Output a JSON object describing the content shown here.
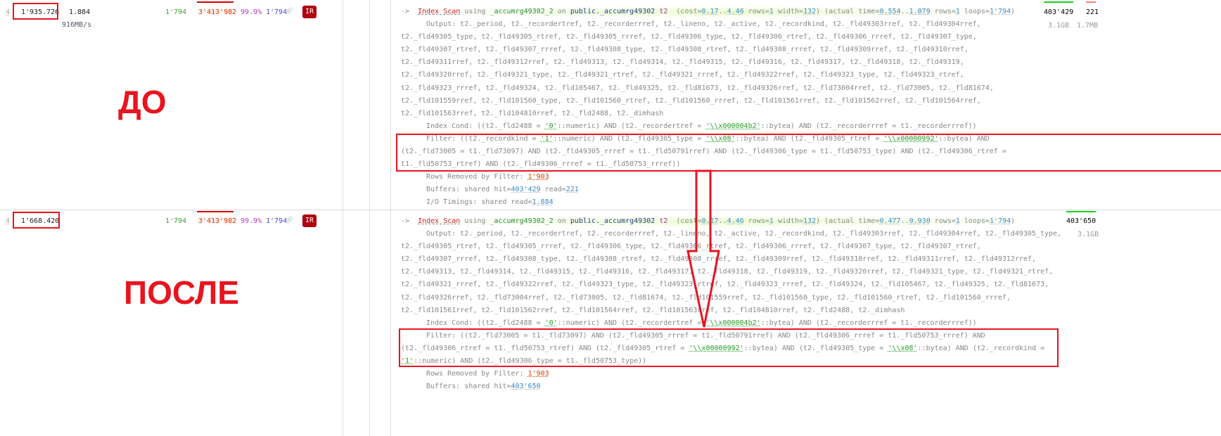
{
  "labels": {
    "before": "ДО",
    "after": "ПОСЛЕ"
  },
  "plans": [
    {
      "row_number": "4",
      "exclusive_time": "1'935.726",
      "io_time": "1.884",
      "io_rate": "916MB/s",
      "loops": "1'794",
      "rows_total": "3'413'982",
      "percent": "99.9%",
      "rows_out": "1'794",
      "badge": "IR",
      "shared_hit": "403'429",
      "shared_read": "221",
      "hit_size": "3.1GB",
      "read_size": "1.7MB",
      "lines": [
        {
          "indent": 0,
          "seg": [
            [
              "->  ",
              ""
            ],
            [
              "Index Scan",
              "op"
            ],
            [
              " using ",
              ""
            ],
            [
              "_accumrg49302_2",
              "idx"
            ],
            [
              " on ",
              ""
            ],
            [
              "public._accumrg49302",
              "tbl"
            ],
            [
              " t2",
              "alias"
            ],
            [
              "  (cost=",
              ""
            ],
            [
              "0.17",
              "num"
            ],
            [
              "..",
              ""
            ],
            [
              "4.46",
              "num"
            ],
            [
              " rows=",
              ""
            ],
            [
              "1",
              "num"
            ],
            [
              " width=",
              ""
            ],
            [
              "132",
              "num"
            ],
            [
              ") (actual time=",
              ""
            ],
            [
              "0.554",
              "num"
            ],
            [
              "..",
              ""
            ],
            [
              "1.079",
              "num"
            ],
            [
              " rows=",
              ""
            ],
            [
              "1",
              "num"
            ],
            [
              " loops=",
              ""
            ],
            [
              "1'794",
              "num"
            ],
            [
              ")",
              ""
            ]
          ]
        },
        {
          "indent": 6,
          "seg": [
            [
              "Output: t2._period, t2._recordertref, t2._recorderrref, t2._lineno, t2._active, t2._recordkind, t2._fld49303rref, t2._fld49304rref,",
              ""
            ]
          ]
        },
        {
          "indent": 0,
          "seg": [
            [
              "t2._fld49305_type, t2._fld49305_rtref, t2._fld49305_rrref, t2._fld49306_type, t2._fld49306_rtref, t2._fld49306_rrref, t2._fld49307_type,",
              ""
            ]
          ]
        },
        {
          "indent": 0,
          "seg": [
            [
              "t2._fld49307_rtref, t2._fld49307_rrref, t2._fld49308_type, t2._fld49308_rtref, t2._fld49308_rrref, t2._fld49309rref, t2._fld49310rref,",
              ""
            ]
          ]
        },
        {
          "indent": 0,
          "seg": [
            [
              "t2._fld49311rref, t2._fld49312rref, t2._fld49313, t2._fld49314, t2._fld49315, t2._fld49316, t2._fld49317, t2._fld49318, t2._fld49319,",
              ""
            ]
          ]
        },
        {
          "indent": 0,
          "seg": [
            [
              "t2._fld49320rref, t2._fld49321_type, t2._fld49321_rtref, t2._fld49321_rrref, t2._fld49322rref, t2._fld49323_type, t2._fld49323_rtref,",
              ""
            ]
          ]
        },
        {
          "indent": 0,
          "seg": [
            [
              "t2._fld49323_rrref, t2._fld49324, t2._fld105467, t2._fld49325, t2._fld81673, t2._fld49326rref, t2._fld73004rref, t2._fld73005, t2._fld81674,",
              ""
            ]
          ]
        },
        {
          "indent": 0,
          "seg": [
            [
              "t2._fld101559rref, t2._fld101560_type, t2._fld101560_rtref, t2._fld101560_rrref, t2._fld101561rref, t2._fld101562rref, t2._fld101564rref,",
              ""
            ]
          ]
        },
        {
          "indent": 0,
          "seg": [
            [
              "t2._fld101563rref, t2._fld104810rref, t2._fld2488, t2._dimhash",
              ""
            ]
          ]
        },
        {
          "indent": 6,
          "seg": [
            [
              "Index Cond: ((t2._fld2488 = ",
              ""
            ],
            [
              "'0'",
              "lit"
            ],
            [
              "::numeric) AND (t2._recordertref = ",
              ""
            ],
            [
              "'\\\\x000004b2'",
              "lit"
            ],
            [
              "::bytea) AND (t2._recorderrref = t1._recorderrref))",
              ""
            ]
          ]
        },
        {
          "indent": 6,
          "seg": [
            [
              "Filter: ((t2._recordkind = ",
              ""
            ],
            [
              "'1'",
              "lit"
            ],
            [
              "::numeric) AND (t2._fld49305_type = ",
              ""
            ],
            [
              "'\\\\x08'",
              "lit"
            ],
            [
              "::bytea) AND (t2._fld49305_rtref = ",
              ""
            ],
            [
              "'\\\\x00000992'",
              "lit"
            ],
            [
              "::bytea) AND",
              ""
            ]
          ]
        },
        {
          "indent": 0,
          "seg": [
            [
              "(t2._fld73005 = t1._fld73097) AND (t2._fld49305_rrref = t1._fld50791rref) AND (t2._fld49306_type = t1._fld50753_type) AND (t2._fld49306_rtref =",
              ""
            ]
          ]
        },
        {
          "indent": 0,
          "seg": [
            [
              "t1._fld50753_rtref) AND (t2._fld49306_rrref = t1._fld50753_rrref))",
              ""
            ]
          ]
        },
        {
          "indent": 6,
          "seg": [
            [
              "Rows Removed by Filter: ",
              ""
            ],
            [
              "1'903",
              "redn"
            ]
          ]
        },
        {
          "indent": 6,
          "seg": [
            [
              "Buffers: shared hit=",
              ""
            ],
            [
              "403'429",
              "num"
            ],
            [
              " read=",
              ""
            ],
            [
              "221",
              "num"
            ]
          ]
        },
        {
          "indent": 6,
          "seg": [
            [
              "I/O Timings: shared read=",
              ""
            ],
            [
              "1.884",
              "num"
            ]
          ]
        }
      ]
    },
    {
      "row_number": "4",
      "exclusive_time": "1'668.420",
      "loops": "1'794",
      "rows_total": "3'413'982",
      "percent": "99.9%",
      "rows_out": "1'794",
      "badge": "IR",
      "shared_hit": "403'650",
      "hit_size": "3.1GB",
      "lines": [
        {
          "indent": 0,
          "seg": [
            [
              "->  ",
              ""
            ],
            [
              "Index Scan",
              "op"
            ],
            [
              " using ",
              ""
            ],
            [
              "_accumrg49302_2",
              "idx"
            ],
            [
              " on ",
              ""
            ],
            [
              "public._accumrg49302",
              "tbl"
            ],
            [
              " t2",
              "alias"
            ],
            [
              "  (cost=",
              ""
            ],
            [
              "0.17",
              "num"
            ],
            [
              "..",
              ""
            ],
            [
              "4.46",
              "num"
            ],
            [
              " rows=",
              ""
            ],
            [
              "1",
              "num"
            ],
            [
              " width=",
              ""
            ],
            [
              "132",
              "num"
            ],
            [
              ") (actual time=",
              ""
            ],
            [
              "0.477",
              "num"
            ],
            [
              "..",
              ""
            ],
            [
              "0.930",
              "num"
            ],
            [
              " rows=",
              ""
            ],
            [
              "1",
              "num"
            ],
            [
              " loops=",
              ""
            ],
            [
              "1'794",
              "num"
            ],
            [
              ")",
              ""
            ]
          ]
        },
        {
          "indent": 6,
          "seg": [
            [
              "Output: t2._period, t2._recordertref, t2._recorderrref, t2._lineno, t2._active, t2._recordkind, t2._fld49303rref, t2._fld49304rref, t2._fld49305_type,",
              ""
            ]
          ]
        },
        {
          "indent": 0,
          "seg": [
            [
              "t2._fld49305_rtref, t2._fld49305_rrref, t2._fld49306_type, t2._fld49306_rtref, t2._fld49306_rrref, t2._fld49307_type, t2._fld49307_rtref,",
              ""
            ]
          ]
        },
        {
          "indent": 0,
          "seg": [
            [
              "t2._fld49307_rrref, t2._fld49308_type, t2._fld49308_rtref, t2._fld49308_rrref, t2._fld49309rref, t2._fld49310rref, t2._fld49311rref, t2._fld49312rref,",
              ""
            ]
          ]
        },
        {
          "indent": 0,
          "seg": [
            [
              "t2._fld49313, t2._fld49314, t2._fld49315, t2._fld49316, t2._fld49317, t2._fld49318, t2._fld49319, t2._fld49320rref, t2._fld49321_type, t2._fld49321_rtref,",
              ""
            ]
          ]
        },
        {
          "indent": 0,
          "seg": [
            [
              "t2._fld49321_rrref, t2._fld49322rref, t2._fld49323_type, t2._fld49323_rtref, t2._fld49323_rrref, t2._fld49324, t2._fld105467, t2._fld49325, t2._fld81673,",
              ""
            ]
          ]
        },
        {
          "indent": 0,
          "seg": [
            [
              "t2._fld49326rref, t2._fld73004rref, t2._fld73005, t2._fld81674, t2._fld101559rref, t2._fld101560_type, t2._fld101560_rtref, t2._fld101560_rrref,",
              ""
            ]
          ]
        },
        {
          "indent": 0,
          "seg": [
            [
              "t2._fld101561rref, t2._fld101562rref, t2._fld101564rref, t2._fld101563rref, t2._fld104810rref, t2._fld2488, t2._dimhash",
              ""
            ]
          ]
        },
        {
          "indent": 6,
          "seg": [
            [
              "Index Cond: ((t2._fld2488 = ",
              ""
            ],
            [
              "'0'",
              "lit"
            ],
            [
              "::numeric) AND (t2._recordertref = ",
              ""
            ],
            [
              "'\\\\x000004b2'",
              "lit"
            ],
            [
              "::bytea) AND (t2._recorderrref = t1._recorderrref))",
              ""
            ]
          ]
        },
        {
          "indent": 6,
          "seg": [
            [
              "Filter: ((t2._fld73005 = t1._fld73097) AND (t2._fld49305_rrref = t1._fld50791rref) AND (t2._fld49306_rrref = t1._fld50753_rrref) AND",
              ""
            ]
          ]
        },
        {
          "indent": 0,
          "seg": [
            [
              "(t2._fld49306_rtref = t1._fld50753_rtref) AND (t2._fld49305_rtref = ",
              ""
            ],
            [
              "'\\\\x00000992'",
              "lit"
            ],
            [
              "::bytea) AND (t2._fld49305_type = ",
              ""
            ],
            [
              "'\\\\x08'",
              "lit"
            ],
            [
              "::bytea) AND (t2._recordkind =",
              ""
            ]
          ]
        },
        {
          "indent": 0,
          "seg": [
            [
              "'1'",
              "lit"
            ],
            [
              "::numeric) AND (t2._fld49306_type = t1._fld50753_type))",
              ""
            ]
          ]
        },
        {
          "indent": 6,
          "seg": [
            [
              "Rows Removed by Filter: ",
              ""
            ],
            [
              "1'903",
              "redn"
            ]
          ]
        },
        {
          "indent": 6,
          "seg": [
            [
              "Buffers: shared hit=",
              ""
            ],
            [
              "403'650",
              "num"
            ]
          ]
        }
      ]
    }
  ]
}
